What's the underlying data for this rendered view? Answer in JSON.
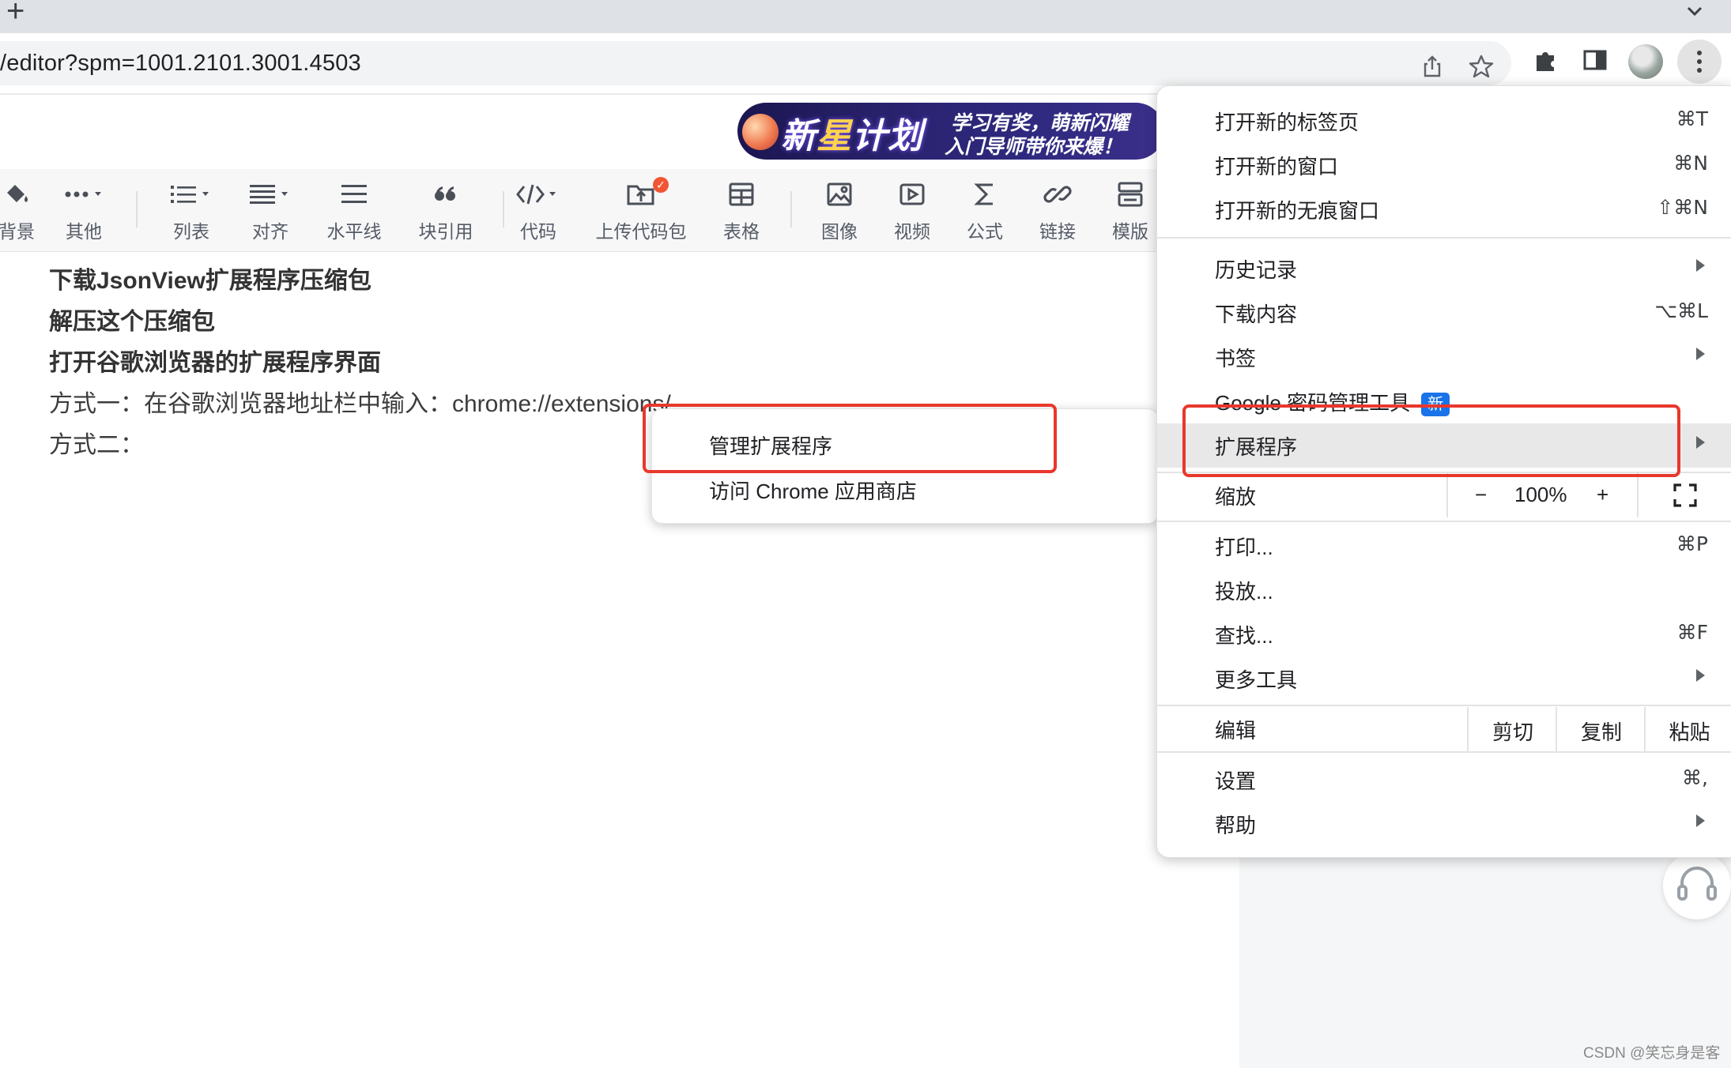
{
  "browser": {
    "url": "/editor?spm=1001.2101.3001.4503",
    "icons": [
      "share-icon",
      "star-icon",
      "puzzle-icon",
      "sidepanel-icon",
      "avatar",
      "kebab-menu-icon"
    ]
  },
  "banner": {
    "title_left": "新",
    "title_star": "星",
    "title_right": "计划",
    "line1": "学习有奖，萌新闪耀",
    "line2": "入门导师带你来爆！"
  },
  "editor_toolbar": {
    "items": [
      {
        "label": "背景",
        "icon": "paint-bucket-icon"
      },
      {
        "label": "其他",
        "icon": "more-dots-icon"
      },
      {
        "label": "列表",
        "icon": "list-icon"
      },
      {
        "label": "对齐",
        "icon": "align-icon"
      },
      {
        "label": "水平线",
        "icon": "horizontal-line-icon"
      },
      {
        "label": "块引用",
        "icon": "quote-icon"
      },
      {
        "label": "代码",
        "icon": "code-icon"
      },
      {
        "label": "上传代码包",
        "icon": "upload-folder-icon"
      },
      {
        "label": "表格",
        "icon": "table-icon"
      },
      {
        "label": "图像",
        "icon": "image-icon"
      },
      {
        "label": "视频",
        "icon": "video-icon"
      },
      {
        "label": "公式",
        "icon": "sigma-icon"
      },
      {
        "label": "链接",
        "icon": "link-icon"
      },
      {
        "label": "模版",
        "icon": "template-icon"
      }
    ]
  },
  "content": {
    "lines": [
      "下载JsonView扩展程序压缩包",
      "解压这个压缩包",
      "打开谷歌浏览器的扩展程序界面",
      "方式一：在谷歌浏览器地址栏中输入：chrome://extensions/",
      "方式二："
    ]
  },
  "submenu": {
    "items": [
      "管理扩展程序",
      "访问 Chrome 应用商店"
    ]
  },
  "chrome_menu": {
    "new_tab": {
      "label": "打开新的标签页",
      "shortcut": "⌘T"
    },
    "new_window": {
      "label": "打开新的窗口",
      "shortcut": "⌘N"
    },
    "incognito": {
      "label": "打开新的无痕窗口",
      "shortcut": "⇧⌘N"
    },
    "history": {
      "label": "历史记录"
    },
    "downloads": {
      "label": "下载内容",
      "shortcut": "⌥⌘L"
    },
    "bookmarks": {
      "label": "书签"
    },
    "passwords": {
      "label": "Google 密码管理工具",
      "badge": "新"
    },
    "extensions": {
      "label": "扩展程序"
    },
    "zoom": {
      "label": "缩放",
      "minus": "−",
      "value": "100%",
      "plus": "+"
    },
    "print": {
      "label": "打印...",
      "shortcut": "⌘P"
    },
    "cast": {
      "label": "投放..."
    },
    "find": {
      "label": "查找...",
      "shortcut": "⌘F"
    },
    "more_tools": {
      "label": "更多工具"
    },
    "edit": {
      "label": "编辑",
      "cut": "剪切",
      "copy": "复制",
      "paste": "粘贴"
    },
    "settings": {
      "label": "设置",
      "shortcut": "⌘,"
    },
    "help": {
      "label": "帮助"
    }
  },
  "watermark": "CSDN @笑忘身是客",
  "colors": {
    "highlight_red": "#e8382c",
    "badge_blue": "#1a73e8",
    "upload_badge": "#f25533"
  }
}
